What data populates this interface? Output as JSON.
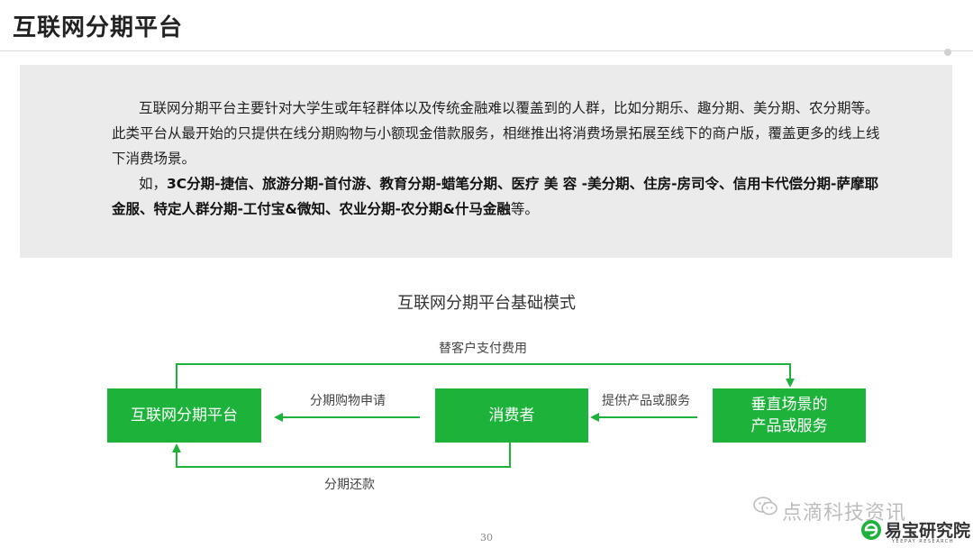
{
  "header": {
    "title": "互联网分期平台"
  },
  "intro": {
    "paragraph_1": "互联网分期平台主要针对大学生或年轻群体以及传统金融难以覆盖到的人群，比如分期乐、趣分期、美分期、农分期等。此类平台从最开始的只提供在线分期购物与小额现金借款服务，相继推出将消费场景拓展至线下的商户版，覆盖更多的线上线下消费场景。",
    "paragraph_2_prefix": "如，",
    "paragraph_2_examples": "3C分期-捷信、旅游分期-首付游、教育分期-蜡笔分期、医疗 美 容 -美分期、住房-房司令、信用卡代偿分期-萨摩耶金服、特定人群分期-工付宝&微知、农业分期-农分期&什马金融",
    "paragraph_2_suffix": "等。"
  },
  "diagram": {
    "title": "互联网分期平台基础模式",
    "nodes": {
      "platform": "互联网分期平台",
      "consumer": "消费者",
      "vertical_line1": "垂直场景的",
      "vertical_line2": "产品或服务"
    },
    "edges": {
      "pay_on_behalf": "替客户支付费用",
      "installment_application": "分期购物申请",
      "provide_products": "提供产品或服务",
      "repayment": "分期还款"
    },
    "colors": {
      "node_fill": "#1db33b",
      "arrow": "#1db33b"
    }
  },
  "footer": {
    "page_number": "30",
    "watermark": "点滴科技资讯",
    "brand_name": "易宝研究院",
    "brand_sub": "YEEPAY RESEARCH"
  },
  "icons": {
    "wechat": "wechat-icon",
    "brand": "yeepay-logo-icon"
  }
}
